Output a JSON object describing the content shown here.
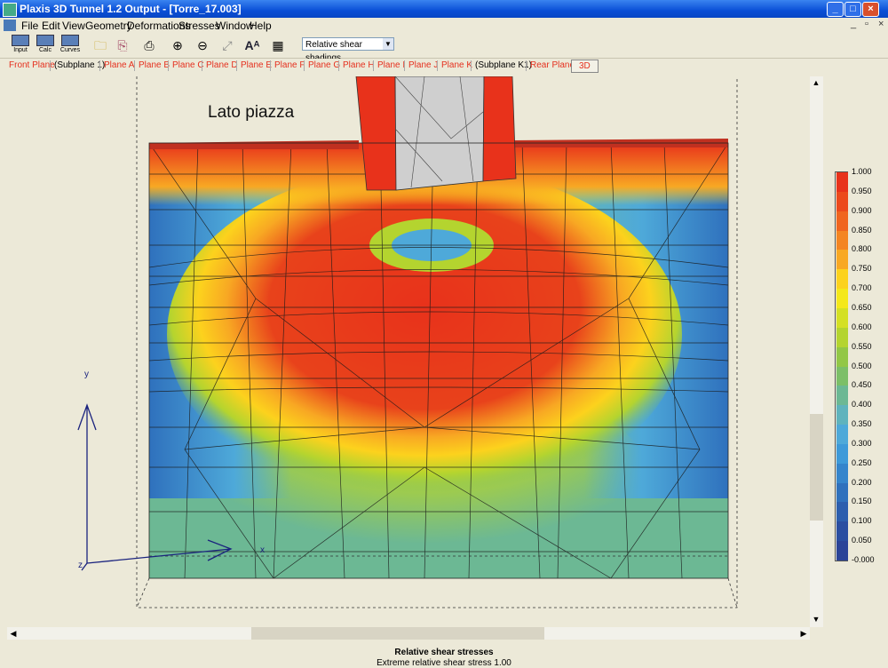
{
  "window": {
    "title": "Plaxis 3D Tunnel 1.2 Output - [Torre_17.003]",
    "buttons": [
      "_",
      "□",
      "×"
    ]
  },
  "menu": {
    "items": [
      "File",
      "Edit",
      "View",
      "Geometry",
      "Deformations",
      "Stresses",
      "Window",
      "Help"
    ],
    "mdi_buttons": [
      "_",
      "▫",
      "×"
    ]
  },
  "toolbar": {
    "input_label": "Input",
    "calc_label": "Calc",
    "curves_label": "Curves",
    "icons": [
      "open-folder",
      "copy",
      "print",
      "zoom-in",
      "zoom-out",
      "reset-view",
      "labels",
      "table"
    ],
    "view_select": "Relative shear shadings"
  },
  "planes": {
    "tabs": [
      "Front Plane",
      "(Subplane 1)",
      "Plane A",
      "Plane B",
      "Plane C",
      "Plane D",
      "Plane E",
      "Plane F",
      "Plane G",
      "Plane H",
      "Plane I",
      "Plane J",
      "Plane K",
      "(Subplane K1)",
      "Rear Plane",
      "3D"
    ]
  },
  "canvas": {
    "annotation": "Lato piazza",
    "axis_y": "y",
    "axis_x": "x",
    "axis_z": "z"
  },
  "legend": {
    "values": [
      "1.000",
      "0.950",
      "0.900",
      "0.850",
      "0.800",
      "0.750",
      "0.700",
      "0.650",
      "0.600",
      "0.550",
      "0.500",
      "0.450",
      "0.400",
      "0.350",
      "0.300",
      "0.250",
      "0.200",
      "0.150",
      "0.100",
      "0.050",
      "-0.000"
    ],
    "colors": [
      "#e8321b",
      "#ec4a1c",
      "#f0651f",
      "#f48522",
      "#f8a823",
      "#fcd21d",
      "#f4e81a",
      "#d4e024",
      "#b4d42f",
      "#92c746",
      "#7cbf68",
      "#6cb894",
      "#5fb3bd",
      "#4ea9d9",
      "#3e9ad9",
      "#3585cc",
      "#2f71bd",
      "#2c5eae",
      "#2a4ea1",
      "#2b4498"
    ]
  },
  "status": {
    "line1": "Relative shear stresses",
    "line2": "Extreme relative shear stress 1.00"
  }
}
